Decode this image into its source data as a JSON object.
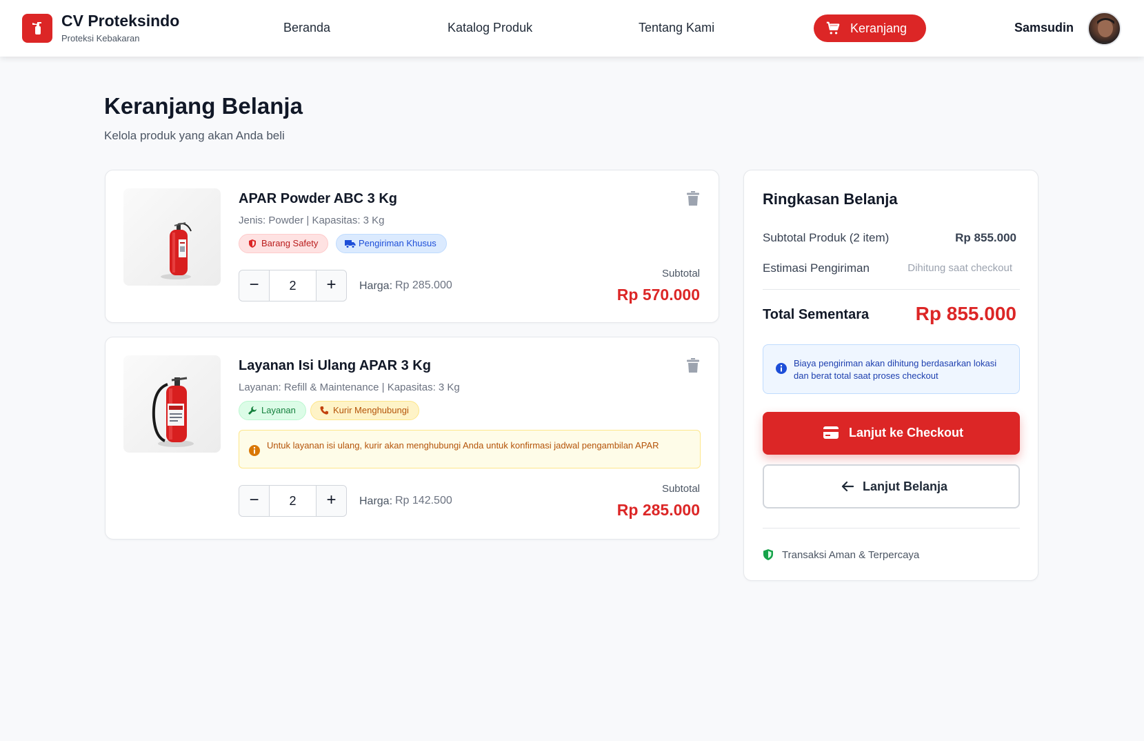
{
  "header": {
    "brand_name": "CV Proteksindo",
    "brand_sub": "Proteksi Kebakaran",
    "nav": [
      "Beranda",
      "Katalog Produk",
      "Tentang Kami"
    ],
    "cart_label": "Keranjang",
    "user_name": "Samsudin"
  },
  "page": {
    "title": "Keranjang Belanja",
    "subtitle": "Kelola produk yang akan Anda beli"
  },
  "items": [
    {
      "name": "APAR Powder ABC 3 Kg",
      "meta": "Jenis: Powder | Kapasitas: 3 Kg",
      "badges": [
        "Barang Safety",
        "Pengiriman Khusus"
      ],
      "qty": "2",
      "price_label": "Harga:",
      "price": "Rp 285.000",
      "subtotal_label": "Subtotal",
      "subtotal": "Rp 570.000"
    },
    {
      "name": "Layanan Isi Ulang APAR 3 Kg",
      "meta": "Layanan: Refill & Maintenance | Kapasitas: 3 Kg",
      "badges": [
        "Layanan",
        "Kurir Menghubungi"
      ],
      "note": "Untuk layanan isi ulang, kurir akan menghubungi Anda untuk konfirmasi jadwal pengambilan APAR",
      "qty": "2",
      "price_label": "Harga:",
      "price": "Rp 142.500",
      "subtotal_label": "Subtotal",
      "subtotal": "Rp 285.000"
    }
  ],
  "summary": {
    "title": "Ringkasan Belanja",
    "subtotal_label": "Subtotal Produk (2 item)",
    "subtotal_value": "Rp 855.000",
    "shipping_label": "Estimasi Pengiriman",
    "shipping_value": "Dihitung saat checkout",
    "total_label": "Total Sementara",
    "total_value": "Rp 855.000",
    "info": "Biaya pengiriman akan dihitung berdasarkan lokasi dan berat total saat proses checkout",
    "checkout_label": "Lanjut ke Checkout",
    "continue_label": "Lanjut Belanja",
    "secure_label": "Transaksi Aman & Terpercaya"
  },
  "colors": {
    "accent": "#dc2626",
    "background": "#f8f9fb"
  }
}
